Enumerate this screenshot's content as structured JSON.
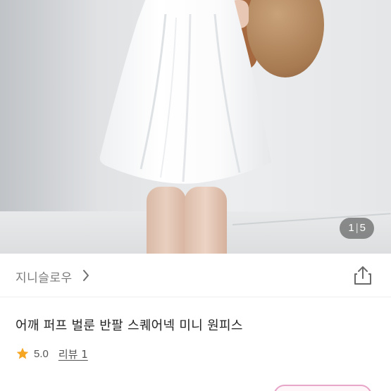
{
  "photo": {
    "current": "1",
    "separator": "|",
    "total": "5"
  },
  "shop": {
    "name": "지니슬로우"
  },
  "product": {
    "title": "어깨 퍼프 벌룬 반팔 스퀘어넥 미니 원피스",
    "rating": "5.0",
    "review_label": "리뷰 1"
  },
  "colors": {
    "star": "#f5a623",
    "accent_pink": "#e8a5c8",
    "text_primary": "#222222",
    "text_secondary": "#7a7a7a"
  },
  "icons": {
    "shop_chevron": "chevron-right-icon",
    "share": "share-icon",
    "rating_star": "star-icon"
  }
}
